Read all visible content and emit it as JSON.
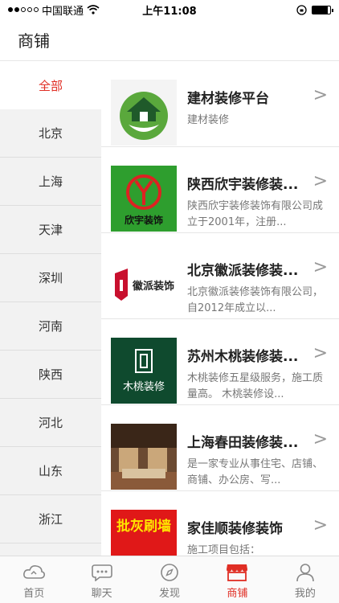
{
  "status": {
    "carrier": "中国联通",
    "time": "上午11:08"
  },
  "header": {
    "title": "商铺"
  },
  "sidebar": {
    "items": [
      {
        "label": "全部"
      },
      {
        "label": "北京"
      },
      {
        "label": "上海"
      },
      {
        "label": "天津"
      },
      {
        "label": "深圳"
      },
      {
        "label": "河南"
      },
      {
        "label": "陕西"
      },
      {
        "label": "河北"
      },
      {
        "label": "山东"
      },
      {
        "label": "浙江"
      }
    ]
  },
  "shops": [
    {
      "title": "建材装修平台",
      "desc": "建材装修",
      "thumb_text": ""
    },
    {
      "title": "陕西欣宇装修装...",
      "desc": "陕西欣宇装修装饰有限公司成立于2001年，注册...",
      "thumb_text": "欣宇装饰"
    },
    {
      "title": "北京徽派装修装...",
      "desc": "北京徽派装修装饰有限公司，自2012年成立以...",
      "thumb_text": "徽派装饰"
    },
    {
      "title": "苏州木桃装修装...",
      "desc": "木桃装修五星级服务，施工质量高。 木桃装修设...",
      "thumb_text": "木桃装修"
    },
    {
      "title": "上海春田装修装...",
      "desc": "是一家专业从事住宅、店铺、商铺、办公房、写...",
      "thumb_text": ""
    },
    {
      "title": "家佳顺装修装饰",
      "desc": "施工项目包括：",
      "thumb_text": "批灰刷墙"
    }
  ],
  "chevron": ">",
  "tabs": [
    {
      "label": "首页"
    },
    {
      "label": "聊天"
    },
    {
      "label": "发现"
    },
    {
      "label": "商铺"
    },
    {
      "label": "我的"
    }
  ],
  "colors": {
    "accent": "#e02e24",
    "sidebar_bg": "#f2f2f2"
  }
}
